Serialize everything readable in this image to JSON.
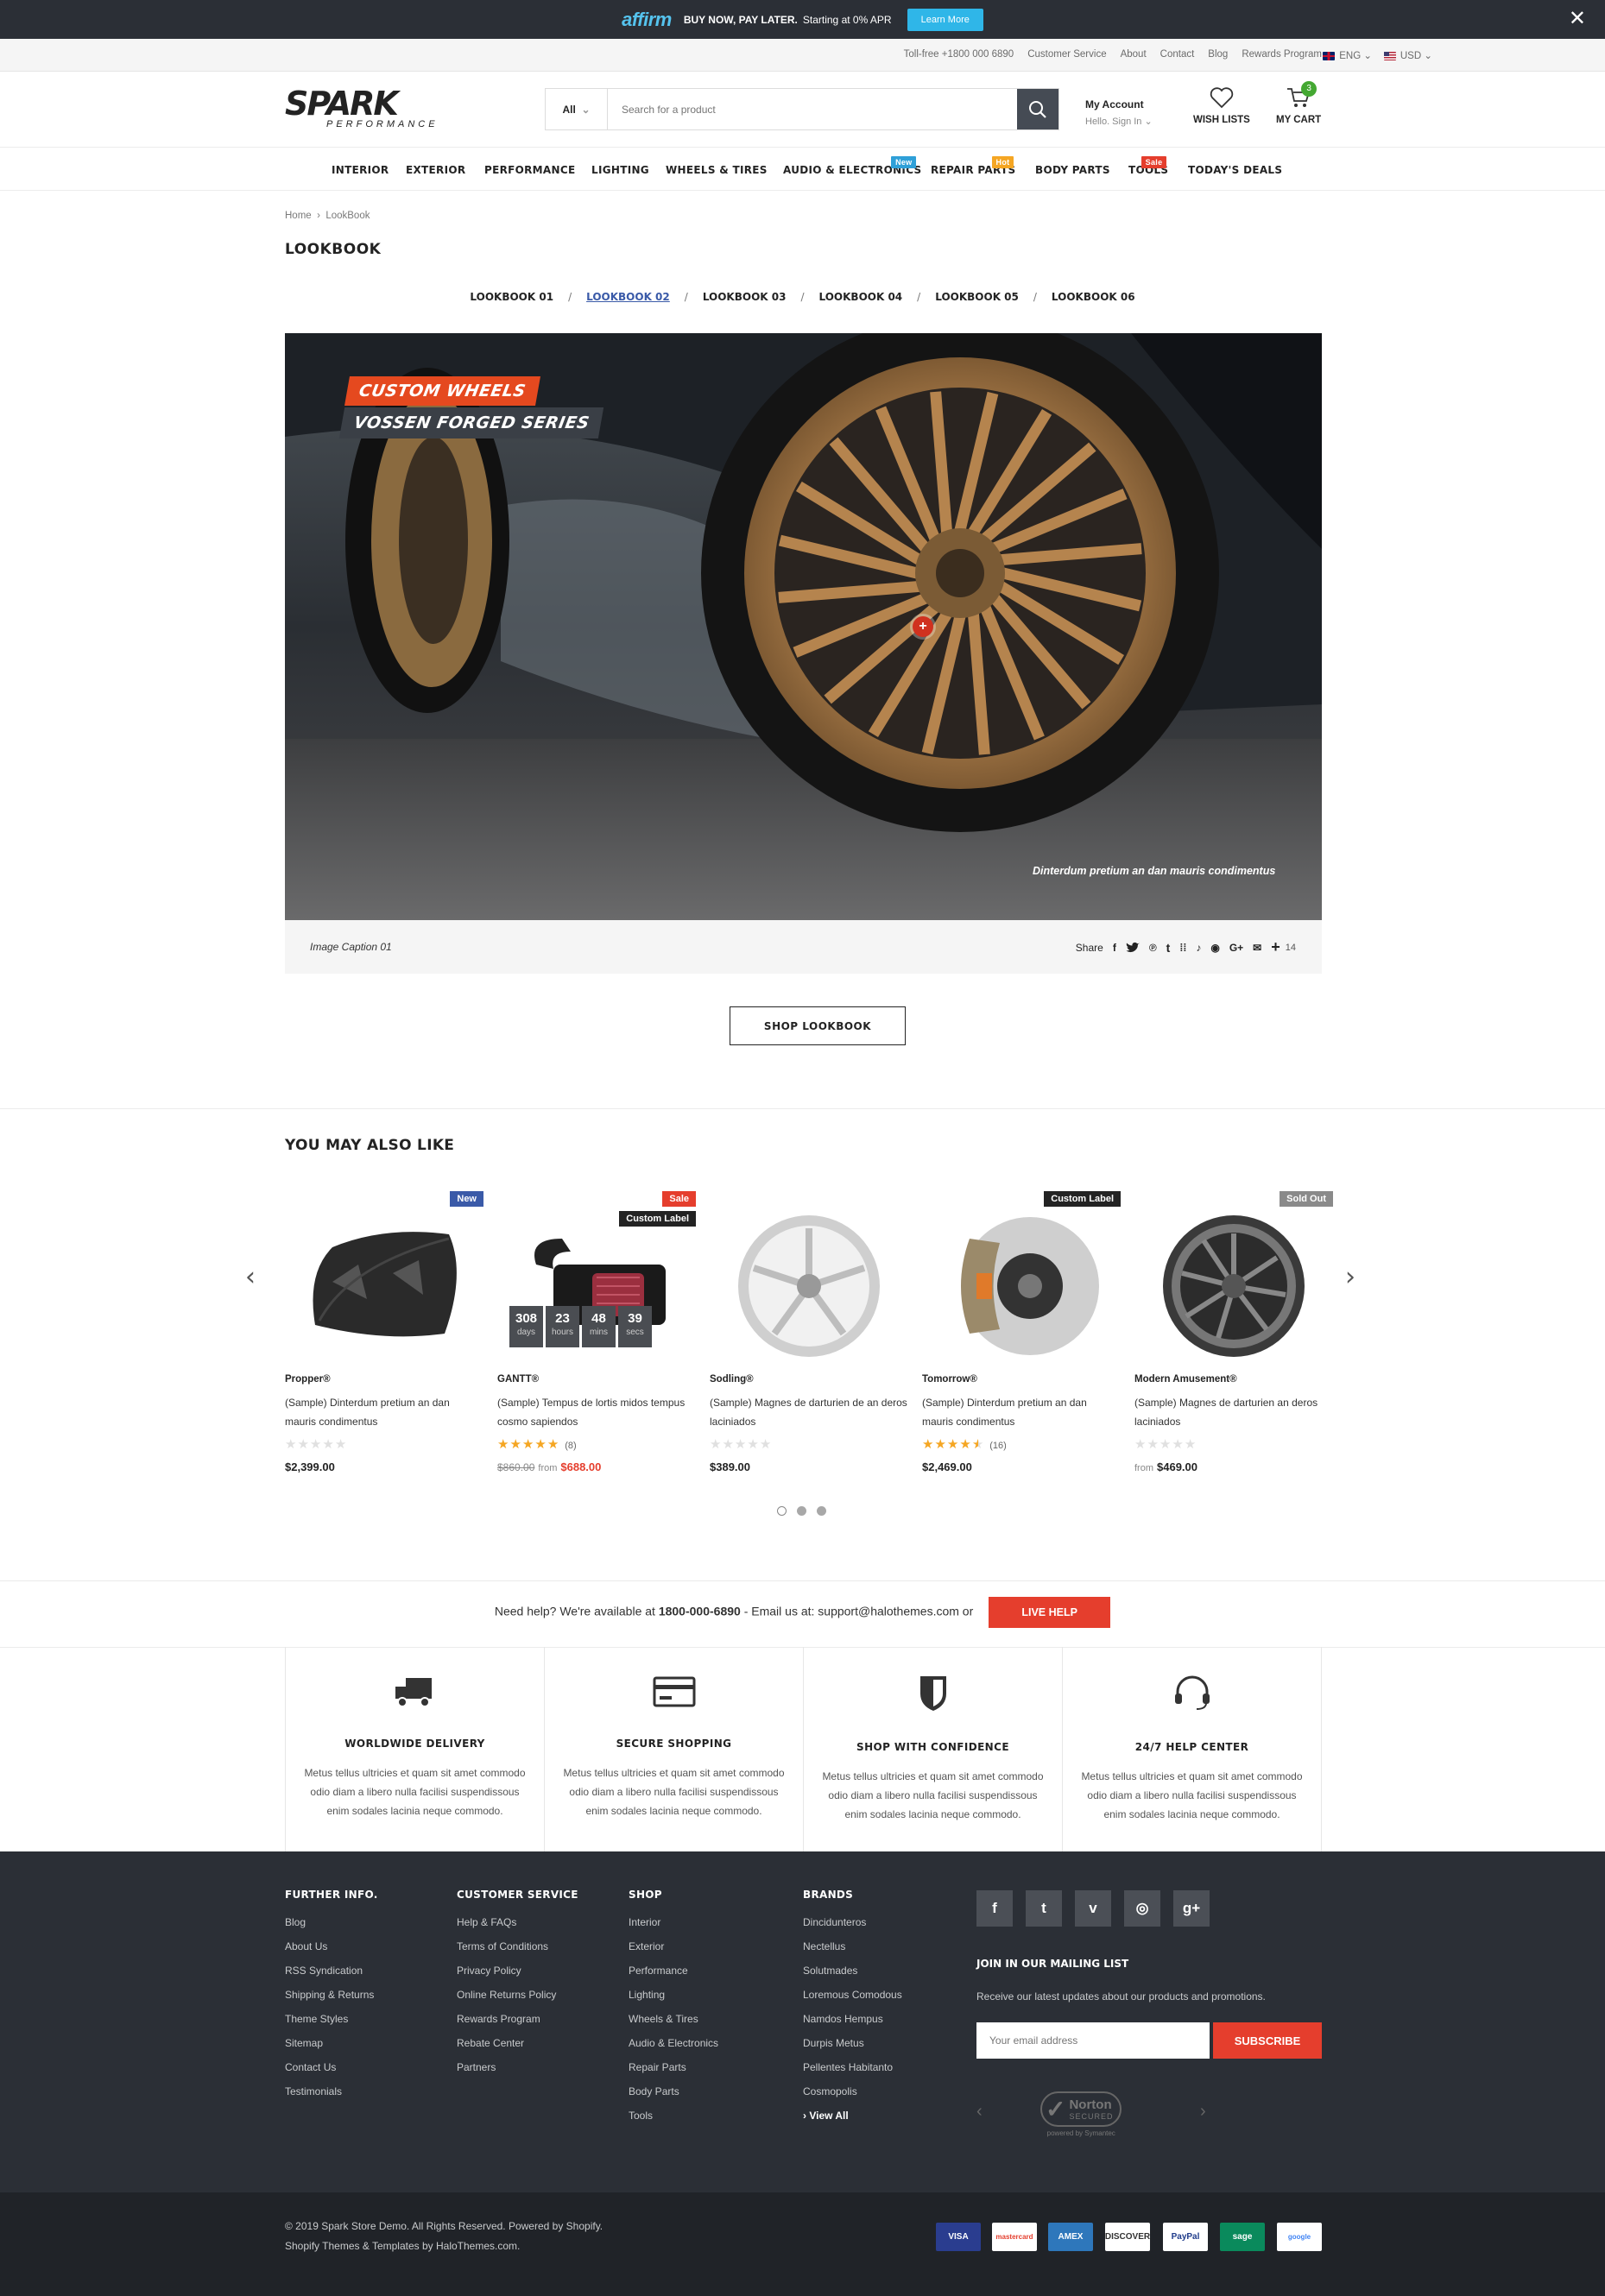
{
  "promo": {
    "brand": "affirm",
    "text_bold": "BUY NOW, PAY LATER.",
    "text": "Starting at 0% APR",
    "button": "Learn More"
  },
  "toplinks": {
    "links": [
      "Toll-free +1800 000 6890",
      "Customer Service",
      "About",
      "Contact",
      "Blog",
      "Rewards Program"
    ],
    "language": "ENG",
    "currency": "USD"
  },
  "header": {
    "logo": "SPARK",
    "logo_sub": "PERFORMANCE",
    "search_category": "All",
    "search_placeholder": "Search for a product",
    "account_title": "My Account",
    "account_sub": "Hello. Sign In",
    "wishlist": "WISH LISTS",
    "cart": "MY CART",
    "cart_count": "3"
  },
  "nav": [
    {
      "label": "INTERIOR"
    },
    {
      "label": "EXTERIOR"
    },
    {
      "label": "PERFORMANCE"
    },
    {
      "label": "LIGHTING"
    },
    {
      "label": "WHEELS & TIRES"
    },
    {
      "label": "AUDIO & ELECTRONICS",
      "badge": "New"
    },
    {
      "label": "REPAIR PARTS",
      "badge": "Hot"
    },
    {
      "label": "BODY PARTS"
    },
    {
      "label": "TOOLS",
      "badge": "Sale"
    },
    {
      "label": "TODAY'S DEALS"
    }
  ],
  "breadcrumb": {
    "home": "Home",
    "current": "LookBook"
  },
  "page_title": "LOOKBOOK",
  "tabs": [
    "LOOKBOOK 01",
    "LOOKBOOK 02",
    "LOOKBOOK 03",
    "LOOKBOOK 04",
    "LOOKBOOK 05",
    "LOOKBOOK 06"
  ],
  "active_tab": "LOOKBOOK 02",
  "hero": {
    "tag1": "CUSTOM WHEELS",
    "tag2": "VOSSEN FORGED SERIES",
    "overlay_caption": "Dinterdum pretium an dan mauris condimentus",
    "hotspot": "+"
  },
  "caption_bar": {
    "caption": "Image Caption 01",
    "share_label": "Share",
    "share_count": "14"
  },
  "shop_button": "SHOP LOOKBOOK",
  "related": {
    "title": "YOU MAY ALSO LIKE",
    "products": [
      {
        "brand": "Propper®",
        "name": "(Sample) Dinterdum pretium an dan mauris condimentus",
        "labels": [
          "New"
        ],
        "rating": 0,
        "reviews": "",
        "price": "$2,399.00",
        "image": "carbon-hood"
      },
      {
        "brand": "GANTT®",
        "name": "(Sample) Tempus de lortis midos tempus cosmo sapiendos",
        "labels": [
          "Sale",
          "Custom Label"
        ],
        "rating": 5,
        "reviews": "(8)",
        "old_price": "$860.00",
        "from": "from",
        "price": "$688.00",
        "image": "air-intake",
        "countdown": [
          {
            "n": "308",
            "l": "days"
          },
          {
            "n": "23",
            "l": "hours"
          },
          {
            "n": "48",
            "l": "mins"
          },
          {
            "n": "39",
            "l": "secs"
          }
        ]
      },
      {
        "brand": "Sodling®",
        "name": "(Sample) Magnes de darturien de an deros laciniados",
        "labels": [],
        "rating": 0,
        "reviews": "",
        "price": "$389.00",
        "image": "silver-wheel"
      },
      {
        "brand": "Tomorrow®",
        "name": "(Sample) Dinterdum pretium an dan mauris condimentus",
        "labels": [
          "Custom Label"
        ],
        "rating": 4.5,
        "reviews": "(16)",
        "price": "$2,469.00",
        "image": "brake-kit"
      },
      {
        "brand": "Modern Amusement®",
        "name": "(Sample) Magnes de darturien an deros laciniados",
        "labels": [
          "Sold Out"
        ],
        "rating": 0,
        "reviews": "",
        "from": "from",
        "price": "$469.00",
        "image": "grey-wheel"
      }
    ]
  },
  "help": {
    "text1": "Need help? We're available at",
    "phone": "1800-000-6890",
    "text2": "- Email us at: support@halothemes.com or",
    "button": "LIVE HELP"
  },
  "features": [
    {
      "icon": "truck-icon",
      "title": "WORLDWIDE DELIVERY",
      "desc": "Metus tellus ultricies et quam sit amet commodo odio diam a libero nulla facilisi suspendissous enim sodales lacinia neque commodo."
    },
    {
      "icon": "credit-card-icon",
      "title": "SECURE SHOPPING",
      "desc": "Metus tellus ultricies et quam sit amet commodo odio diam a libero nulla facilisi suspendissous enim sodales lacinia neque commodo."
    },
    {
      "icon": "shield-icon",
      "title": "SHOP WITH CONFIDENCE",
      "desc": "Metus tellus ultricies et quam sit amet commodo odio diam a libero nulla facilisi suspendissous enim sodales lacinia neque commodo."
    },
    {
      "icon": "headset-icon",
      "title": "24/7 HELP CENTER",
      "desc": "Metus tellus ultricies et quam sit amet commodo odio diam a libero nulla facilisi suspendissous enim sodales lacinia neque commodo."
    }
  ],
  "footer": {
    "cols": [
      {
        "title": "FURTHER INFO.",
        "links": [
          "Blog",
          "About Us",
          "RSS Syndication",
          "Shipping & Returns",
          "Theme Styles",
          "Sitemap",
          "Contact Us",
          "Testimonials"
        ]
      },
      {
        "title": "CUSTOMER SERVICE",
        "links": [
          "Help & FAQs",
          "Terms of Conditions",
          "Privacy Policy",
          "Online Returns Policy",
          "Rewards Program",
          "Rebate Center",
          "Partners"
        ]
      },
      {
        "title": "SHOP",
        "links": [
          "Interior",
          "Exterior",
          "Performance",
          "Lighting",
          "Wheels & Tires",
          "Audio & Electronics",
          "Repair Parts",
          "Body Parts",
          "Tools"
        ]
      },
      {
        "title": "BRANDS",
        "links": [
          "Dincidunteros",
          "Nectellus",
          "Solutmades",
          "Loremous Comodous",
          "Namdos Hempus",
          "Durpis Metus",
          "Pellentes Habitanto",
          "Cosmopolis"
        ],
        "view_all": "View All"
      }
    ],
    "social": [
      "f",
      "t",
      "v",
      "ig",
      "g+"
    ],
    "mailing_title": "JOIN IN OUR MAILING LIST",
    "mailing_text": "Receive our latest updates about our products and promotions.",
    "email_placeholder": "Your email address",
    "subscribe": "SUBSCRIBE",
    "norton": "Norton",
    "norton_sub": "SECURED",
    "norton_by": "powered by Symantec"
  },
  "bottom": {
    "copy1": "© 2019 Spark Store Demo. All Rights Reserved. Powered by Shopify.",
    "copy2": "Shopify Themes & Templates by HaloThemes.com.",
    "payments": [
      "VISA",
      "mastercard",
      "AMEX",
      "DISCOVER",
      "PayPal",
      "sage",
      "google"
    ]
  }
}
